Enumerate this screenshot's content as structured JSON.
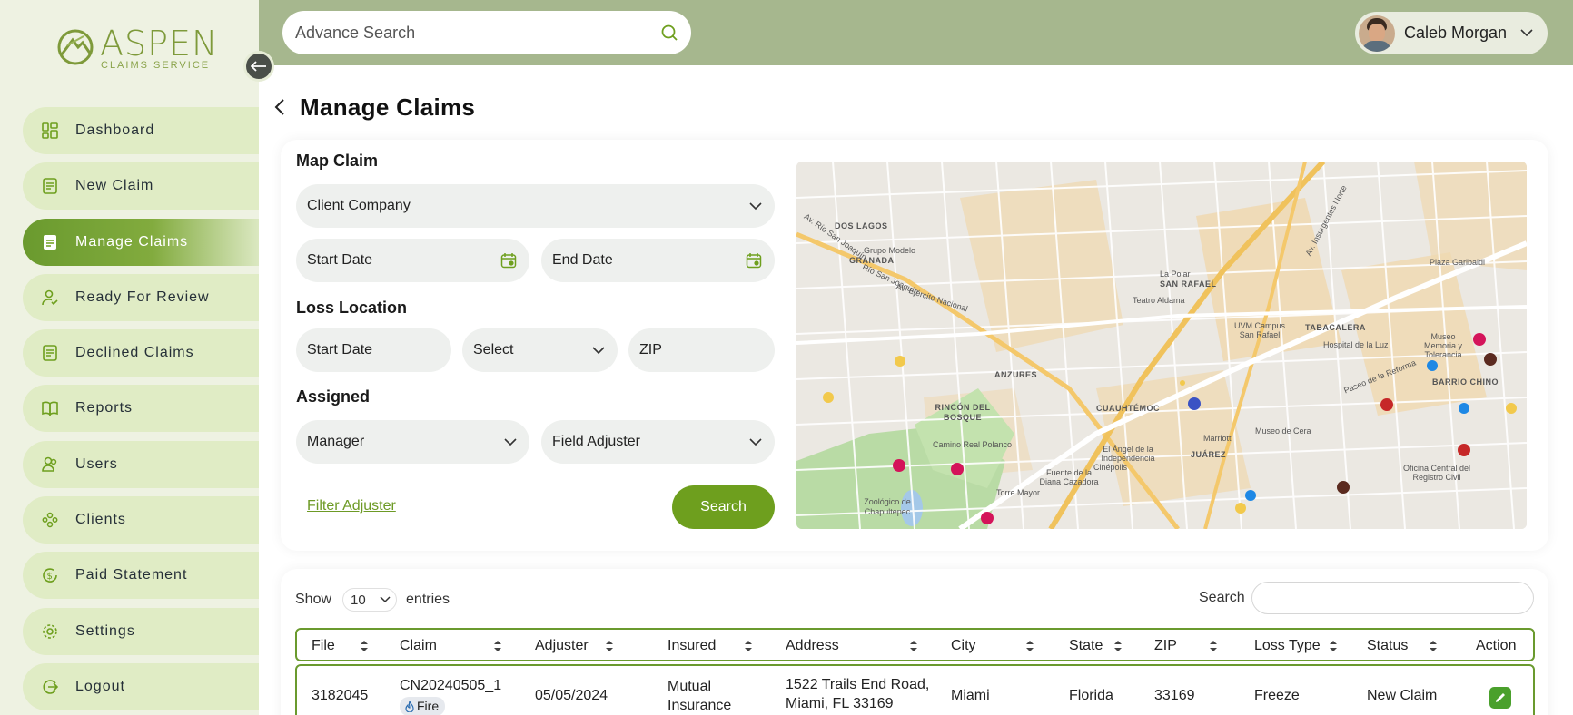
{
  "brand": {
    "name": "ASPEN",
    "subtitle": "CLAIMS SERVICE"
  },
  "sidebar": {
    "items": [
      {
        "label": "Dashboard",
        "icon": "dashboard-icon"
      },
      {
        "label": "New Claim",
        "icon": "document-icon"
      },
      {
        "label": "Manage Claims",
        "icon": "document-icon",
        "active": true
      },
      {
        "label": "Ready For Review",
        "icon": "user-check-icon"
      },
      {
        "label": "Declined Claims",
        "icon": "document-icon"
      },
      {
        "label": "Reports",
        "icon": "book-icon"
      },
      {
        "label": "Users",
        "icon": "users-icon"
      },
      {
        "label": "Clients",
        "icon": "clients-icon"
      },
      {
        "label": "Paid Statement",
        "icon": "dollar-icon"
      },
      {
        "label": "Settings",
        "icon": "gear-icon"
      },
      {
        "label": "Logout",
        "icon": "logout-icon"
      }
    ]
  },
  "topbar": {
    "search_placeholder": "Advance Search",
    "user_name": "Caleb Morgan"
  },
  "page": {
    "title": "Manage Claims"
  },
  "filters": {
    "map_claim_title": "Map Claim",
    "client_company": "Client Company",
    "start_date": "Start Date",
    "end_date": "End Date",
    "loss_location_title": "Loss Location",
    "loss_start_date": "Start Date",
    "select": "Select",
    "zip": "ZIP",
    "assigned_title": "Assigned",
    "manager": "Manager",
    "field_adjuster": "Field Adjuster",
    "filter_adjuster_link": "Filter Adjuster",
    "search_button": "Search"
  },
  "map": {
    "labels": [
      "DOS LAGOS",
      "GRANADA",
      "Grupo Modelo",
      "ANZURES",
      "RINCÓN DEL BOSQUE",
      "Camino Real Polanco",
      "Zoológico de Chapultepec",
      "Torre Mayor",
      "CUAUHTÉMOC",
      "JUÁREZ",
      "SAN RAFAEL",
      "TABACALERA",
      "BARRIO CHINO",
      "Teatro Aldama",
      "UVM Campus San Rafael",
      "Hospital de la Luz",
      "Museo Memoria y Tolerancia",
      "Plaza Garibaldi",
      "Museo de Cera",
      "Marriott",
      "El Ángel de la Independencia",
      "Cinépolis",
      "Fuente de la Diana Cazadora",
      "Oficina Central del Registro Civil",
      "La Polar",
      "Av. Río San Joaquín",
      "Av. Ejército Nacional",
      "Av. Insurgentes Norte",
      "Paseo de la Reforma",
      "Río San Joaquín"
    ]
  },
  "table": {
    "show_label": "Show",
    "entries_value": "10",
    "entries_label": "entries",
    "search_label": "Search",
    "columns": [
      "File",
      "Claim",
      "Adjuster",
      "Insured",
      "Address",
      "City",
      "State",
      "ZIP",
      "Loss Type",
      "Status",
      "Action"
    ],
    "rows": [
      {
        "file": "3182045",
        "claim": "CN20240505_1",
        "claim_tag": "Fire",
        "adjuster": "05/05/2024",
        "insured_line1": "Mutual",
        "insured_line2": "Insurance",
        "address_line1": "1522 Trails End Road,",
        "address_line2": "Miami, FL 33169",
        "city": "Miami",
        "state": "Florida",
        "zip": "33169",
        "loss_type": "Freeze",
        "status": "New Claim"
      }
    ]
  },
  "colors": {
    "accent": "#6e9f1e",
    "sidebar_bg": "#eef2e2",
    "topbar_bg": "#a6b78e",
    "nav_item_bg": "#e0ecc5"
  }
}
